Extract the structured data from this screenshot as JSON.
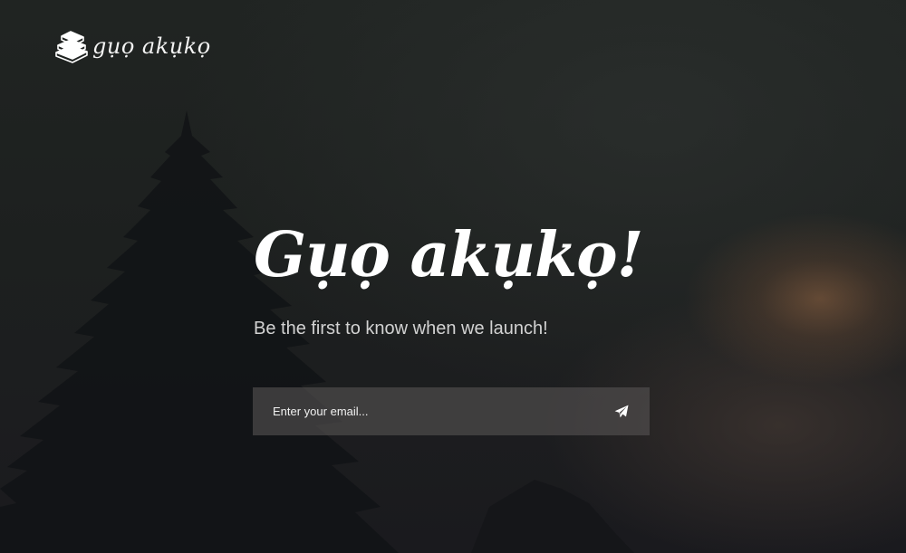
{
  "brand": {
    "logo_text": "gụọ akụkọ",
    "logo_icon": "books-stack-icon"
  },
  "hero": {
    "headline": "Gụọ akụkọ!",
    "tagline": "Be the first to know when we launch!"
  },
  "subscribe": {
    "email_placeholder": "Enter your email...",
    "email_value": "",
    "submit_icon": "paper-plane-icon"
  },
  "colors": {
    "background": "#1c1e1e",
    "text": "#ffffff",
    "tagline": "#d2d2d2",
    "form_background": "#565252",
    "sun_glow": "#7d583c"
  }
}
